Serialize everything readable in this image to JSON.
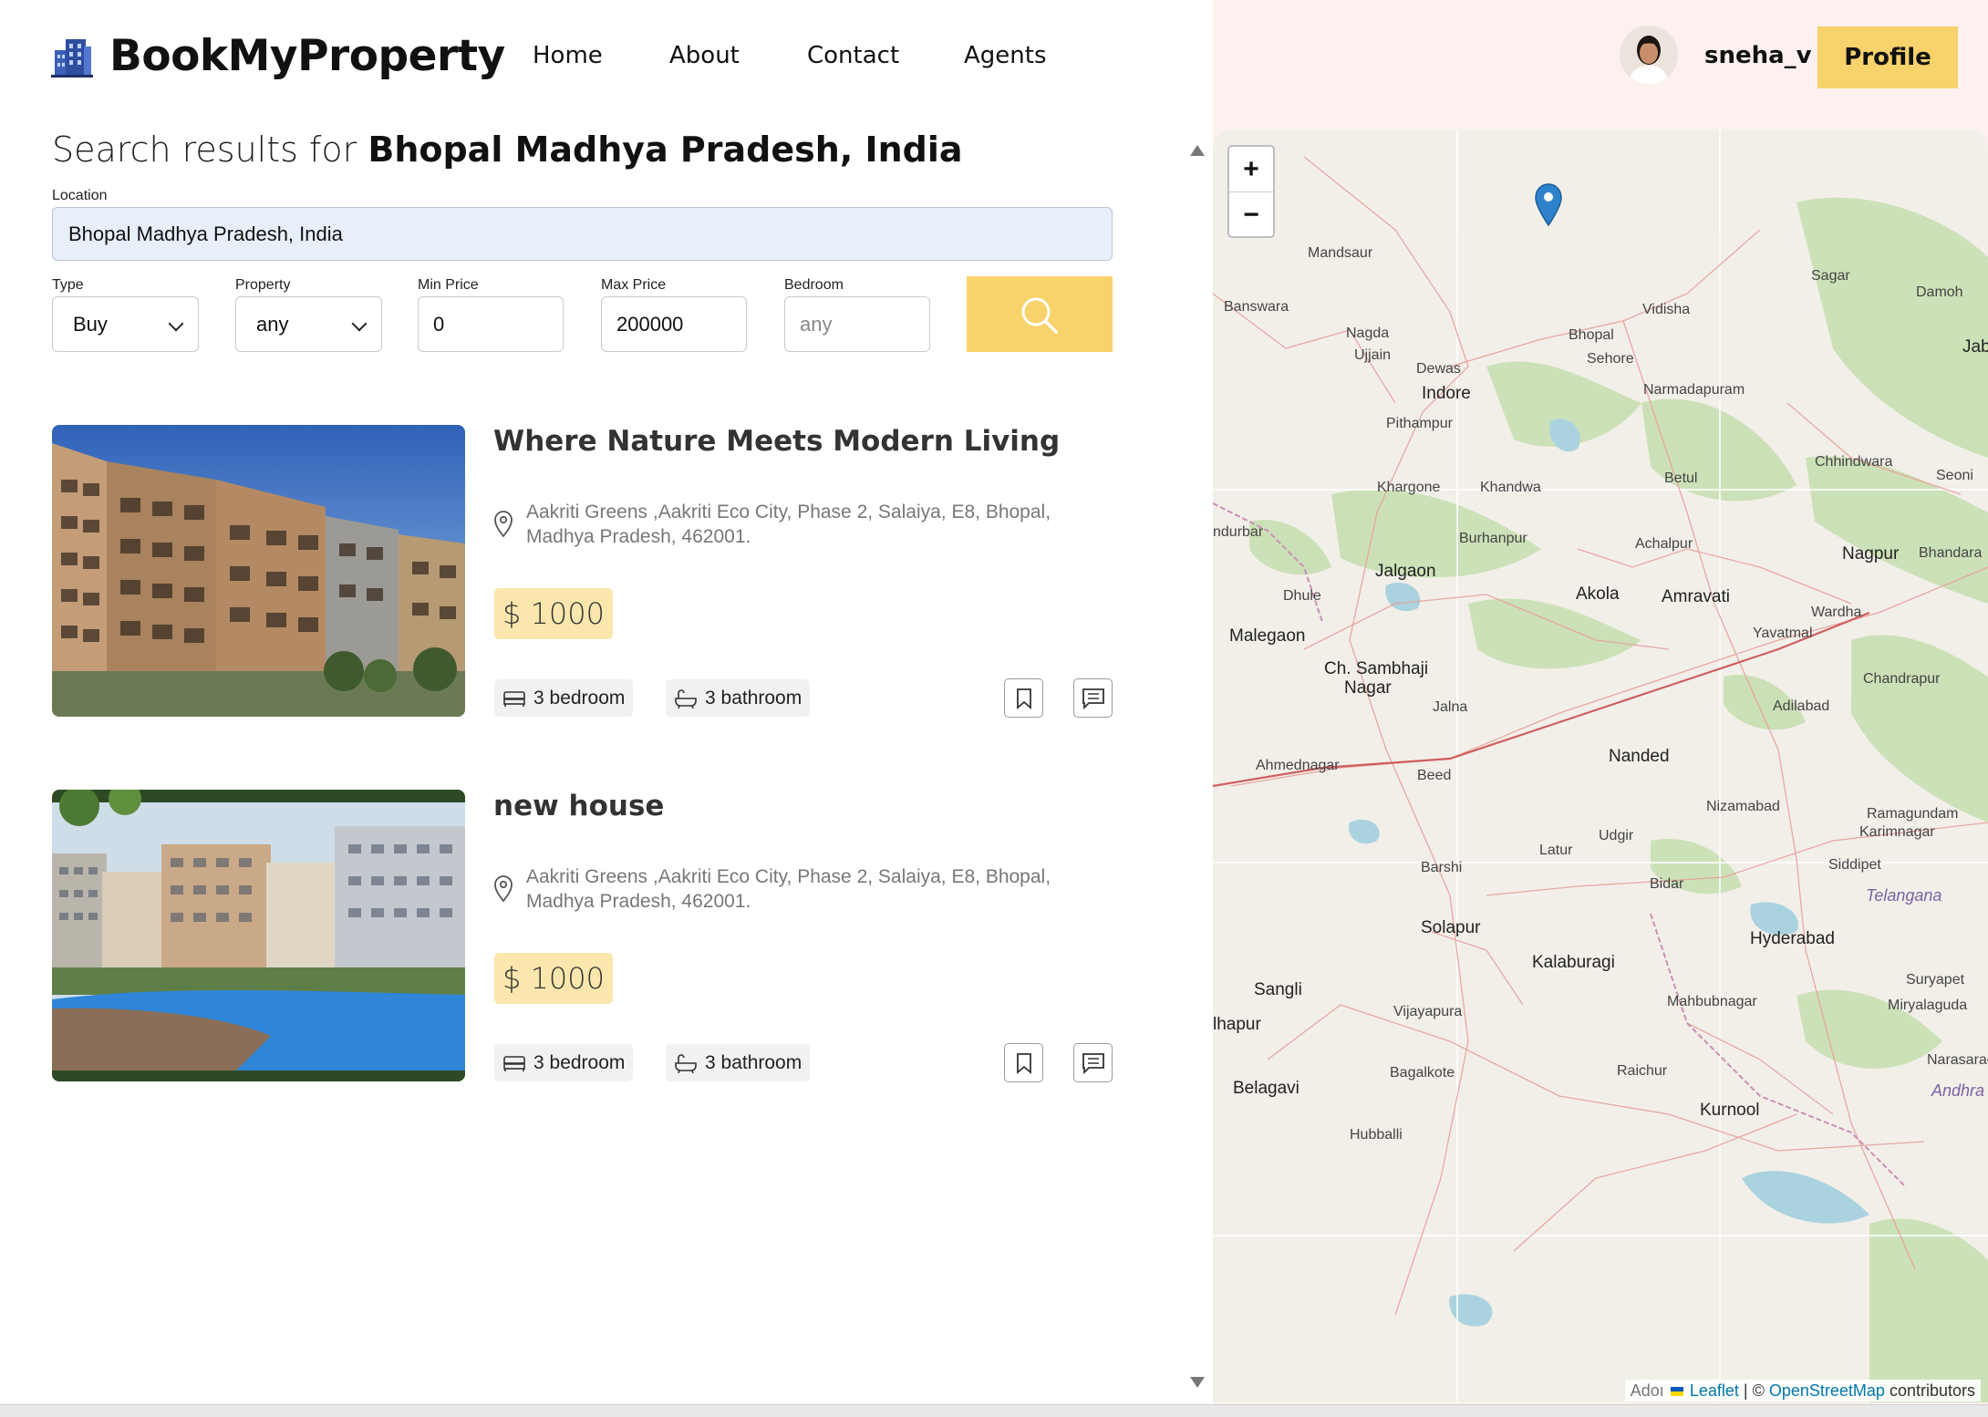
{
  "brand": {
    "name": "BookMyProperty"
  },
  "nav": [
    {
      "label": "Home"
    },
    {
      "label": "About"
    },
    {
      "label": "Contact"
    },
    {
      "label": "Agents"
    }
  ],
  "user": {
    "name": "sneha_v",
    "profile_label": "Profile"
  },
  "search": {
    "heading_prefix": "Search results for",
    "heading_query": "Bhopal Madhya Pradesh, India",
    "location_label": "Location",
    "location_value": "Bhopal Madhya Pradesh, India",
    "type_label": "Type",
    "type_value": "Buy",
    "property_label": "Property",
    "property_value": "any",
    "min_price_label": "Min Price",
    "min_price_value": "0",
    "max_price_label": "Max Price",
    "max_price_value": "200000",
    "bedroom_label": "Bedroom",
    "bedroom_placeholder": "any"
  },
  "listings": [
    {
      "title": "Where Nature Meets Modern Living",
      "address": "Aakriti Greens ,Aakriti Eco City, Phase 2, Salaiya, E8, Bhopal, Madhya Pradesh, 462001.",
      "price": "$ 1000",
      "bedrooms": "3 bedroom",
      "bathrooms": "3 bathroom"
    },
    {
      "title": "new house",
      "address": "Aakriti Greens ,Aakriti Eco City, Phase 2, Salaiya, E8, Bhopal, Madhya Pradesh, 462001.",
      "price": "$ 1000",
      "bedrooms": "3 bedroom",
      "bathrooms": "3 bathroom"
    }
  ],
  "map": {
    "zoom_in": "+",
    "zoom_out": "−",
    "attribution_leaflet": "Leaflet",
    "attribution_sep": "| ©",
    "attribution_osm": "OpenStreetMap",
    "attribution_suffix": "contributors",
    "attribution_prefix": "Adoı",
    "places": [
      "Mandsaur",
      "Banswara",
      "Nagda",
      "Ujjain",
      "Dewas",
      "Indore",
      "Pithampur",
      "Vidisha",
      "Sehore",
      "Bhopal",
      "Narmadapuram",
      "Sagar",
      "Damoh",
      "Jaba",
      "Chhindwara",
      "Seoni",
      "Betul",
      "Khargone",
      "Khandwa",
      "ndurbar",
      "Burhanpur",
      "Achalpur",
      "Nagpur",
      "Bhandara",
      "Jalgaon",
      "Dhule",
      "Akola",
      "Amravati",
      "Wardha",
      "Malegaon",
      "Yavatmal",
      "Ch. Sambhaji",
      "Nagar",
      "Jalna",
      "Chandrapur",
      "Adilabad",
      "Ahmednagar",
      "Beed",
      "Nanded",
      "Nizamabad",
      "Ramagundam",
      "Karimnagar",
      "Udgir",
      "Latur",
      "Siddipet",
      "Barshi",
      "Bidar",
      "Telangana",
      "Solapur",
      "Hyderabad",
      "Kalaburagi",
      "Suryapet",
      "Sangli",
      "Mahbubnagar",
      "Miryalaguda",
      "lhapur",
      "Vijayapura",
      "Bagalkote",
      "Raichur",
      "Narasaraope",
      "Belagavi",
      "Andhra Prade",
      "Kurnool",
      "Hubballi"
    ]
  }
}
